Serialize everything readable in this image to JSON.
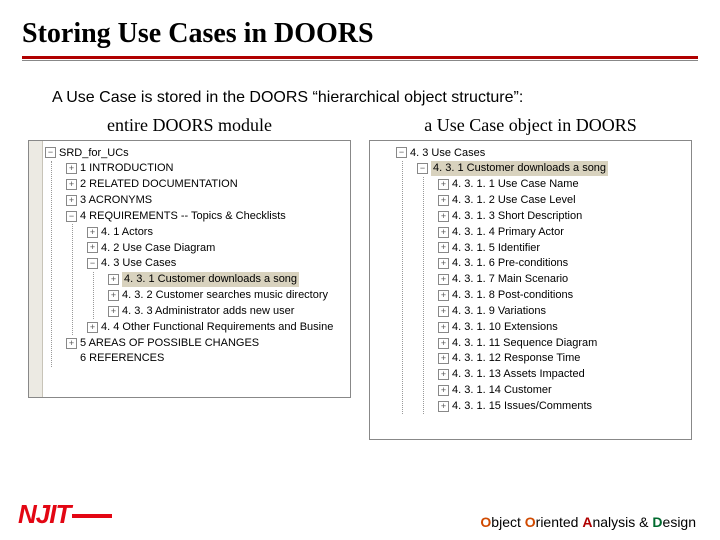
{
  "title": "Storing Use Cases in DOORS",
  "intro": "A Use Case is stored in the DOORS “hierarchical object structure”:",
  "col_left_header": "entire DOORS module",
  "col_right_header": "a Use Case object in DOORS",
  "toggles": {
    "plus": "+",
    "minus": "−"
  },
  "left": {
    "root": "SRD_for_UCs",
    "n1": "1 INTRODUCTION",
    "n2": "2 RELATED DOCUMENTATION",
    "n3": "3 ACRONYMS",
    "n4": "4 REQUIREMENTS -- Topics & Checklists",
    "n41": "4. 1 Actors",
    "n42": "4. 2 Use Case Diagram",
    "n43": "4. 3 Use Cases",
    "n431": "4. 3. 1 Customer downloads a song",
    "n432": "4. 3. 2 Customer searches music directory",
    "n433": "4. 3. 3 Administrator adds new user",
    "n44": "4. 4 Other Functional Requirements and Busine",
    "n5": "5 AREAS OF POSSIBLE CHANGES",
    "n6": "6 REFERENCES"
  },
  "right": {
    "r43": "4. 3 Use Cases",
    "r431": "4. 3. 1 Customer downloads a song",
    "i1": "4. 3. 1. 1 Use Case Name",
    "i2": "4. 3. 1. 2 Use Case Level",
    "i3": "4. 3. 1. 3 Short Description",
    "i4": "4. 3. 1. 4 Primary Actor",
    "i5": "4. 3. 1. 5 Identifier",
    "i6": "4. 3. 1. 6 Pre-conditions",
    "i7": "4. 3. 1. 7 Main Scenario",
    "i8": "4. 3. 1. 8 Post-conditions",
    "i9": "4. 3. 1. 9 Variations",
    "i10": "4. 3. 1. 10 Extensions",
    "i11": "4. 3. 1. 11 Sequence Diagram",
    "i12": "4. 3. 1. 12 Response Time",
    "i13": "4. 3. 1. 13 Assets Impacted",
    "i14": "4. 3. 1. 14 Customer",
    "i15": "4. 3. 1. 15 Issues/Comments"
  },
  "footer": {
    "logo": "NJIT",
    "o": "O",
    "bject": "bject ",
    "o2": "O",
    "riented": "riented ",
    "a": "A",
    "nalysis": "nalysis & ",
    "d": "D",
    "esign": "esign"
  }
}
